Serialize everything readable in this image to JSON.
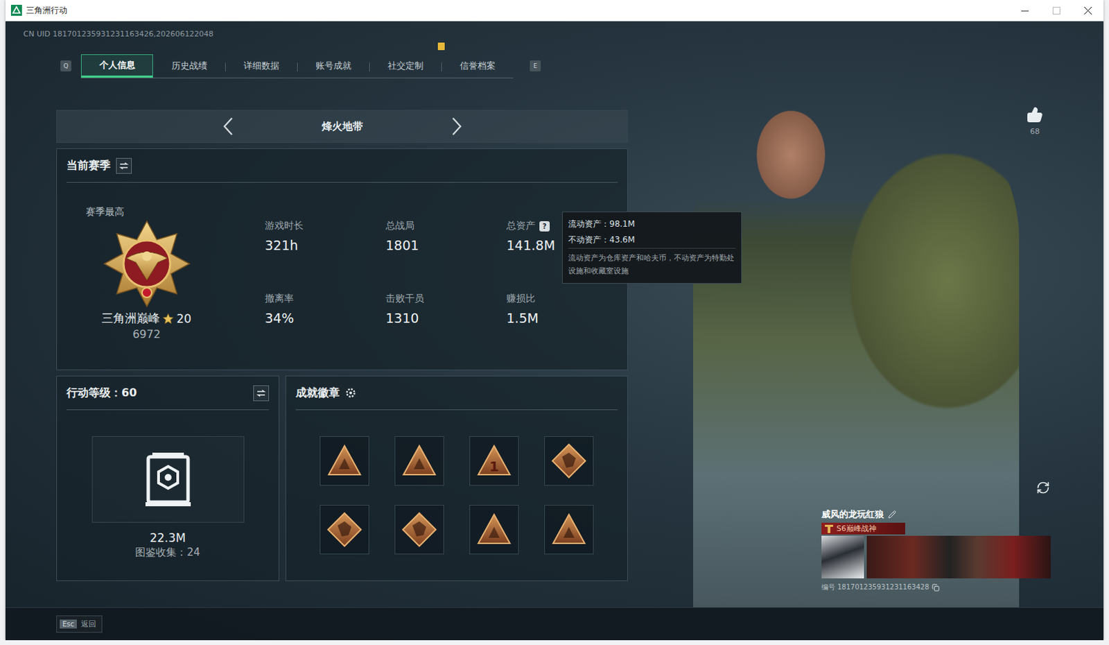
{
  "window": {
    "title": "三角洲行动"
  },
  "uid": "CN UID 181701235931231163426,202606122048",
  "tab_keys": {
    "prev": "Q",
    "next": "E"
  },
  "tabs": [
    {
      "label": "个人信息",
      "selected": true,
      "badge": false
    },
    {
      "label": "历史战绩",
      "selected": false,
      "badge": false
    },
    {
      "label": "详细数据",
      "selected": false,
      "badge": false
    },
    {
      "label": "账号成就",
      "selected": false,
      "badge": false
    },
    {
      "label": "社交定制",
      "selected": false,
      "badge": true
    },
    {
      "label": "信誉档案",
      "selected": false,
      "badge": false
    }
  ],
  "mode": {
    "label": "烽火地带"
  },
  "season": {
    "title": "当前赛季",
    "best_label": "赛季最高",
    "rank": "三角洲巅峰",
    "stars": "20",
    "score": "6972",
    "stats": [
      {
        "label": "游戏时长",
        "value": "321h"
      },
      {
        "label": "总战局",
        "value": "1801"
      },
      {
        "label": "总资产",
        "value": "141.8M",
        "help": "?"
      },
      {
        "label": "撤离率",
        "value": "34%"
      },
      {
        "label": "击败干员",
        "value": "1310"
      },
      {
        "label": "赚损比",
        "value": "1.5M"
      }
    ]
  },
  "tooltip": {
    "lines": [
      "流动资产：98.1M",
      "不动资产：43.6M"
    ],
    "note": "流动资产为仓库资产和哈夫币，不动资产为特勤处设施和收藏室设施"
  },
  "level": {
    "title": "行动等级：60",
    "value": "22.3M",
    "collection": "图鉴收集：24"
  },
  "achievements": {
    "title": "成就徽章",
    "badges": [
      {
        "kind": "triangle",
        "mark": ""
      },
      {
        "kind": "triangle",
        "mark": ""
      },
      {
        "kind": "triangle",
        "mark": "1"
      },
      {
        "kind": "diamond",
        "mark": ""
      },
      {
        "kind": "diamond",
        "mark": ""
      },
      {
        "kind": "diamond",
        "mark": ""
      },
      {
        "kind": "triangle",
        "mark": ""
      },
      {
        "kind": "triangle",
        "mark": ""
      }
    ]
  },
  "likes": "68",
  "player": {
    "name": "威风的龙玩红狼",
    "title": "S6巅峰战神",
    "id": "编号 181701235931231163428"
  },
  "footer": {
    "key": "Esc",
    "label": "返回"
  }
}
